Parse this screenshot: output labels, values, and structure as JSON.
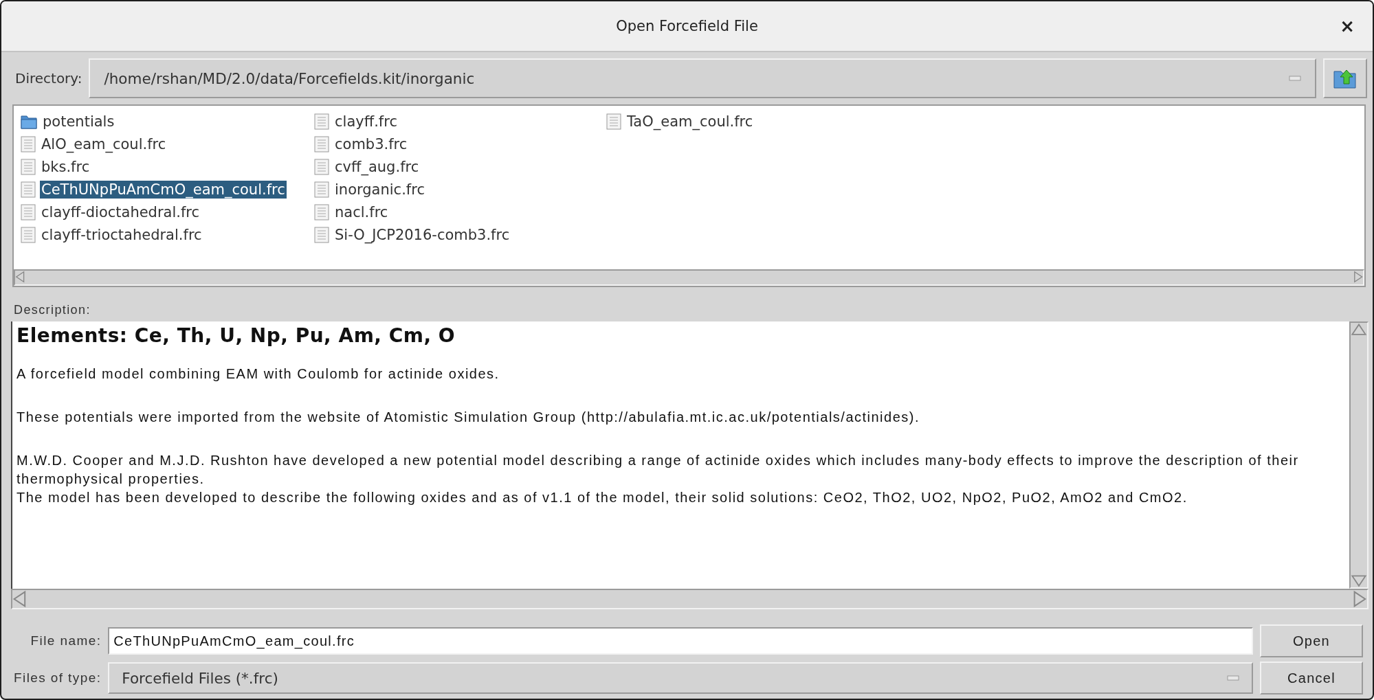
{
  "window": {
    "title": "Open Forcefield File",
    "close": "×"
  },
  "directory": {
    "label": "Directory:",
    "value": "/home/rshan/MD/2.0/data/Forcefields.kit/inorganic"
  },
  "files": [
    {
      "name": "potentials",
      "kind": "folder",
      "selected": false
    },
    {
      "name": "AlO_eam_coul.frc",
      "kind": "file",
      "selected": false
    },
    {
      "name": "bks.frc",
      "kind": "file",
      "selected": false
    },
    {
      "name": "CeThUNpPuAmCmO_eam_coul.frc",
      "kind": "file",
      "selected": true
    },
    {
      "name": "clayff-dioctahedral.frc",
      "kind": "file",
      "selected": false
    },
    {
      "name": "clayff-trioctahedral.frc",
      "kind": "file",
      "selected": false
    },
    {
      "name": "clayff.frc",
      "kind": "file",
      "selected": false
    },
    {
      "name": "comb3.frc",
      "kind": "file",
      "selected": false
    },
    {
      "name": "cvff_aug.frc",
      "kind": "file",
      "selected": false
    },
    {
      "name": "inorganic.frc",
      "kind": "file",
      "selected": false
    },
    {
      "name": "nacl.frc",
      "kind": "file",
      "selected": false
    },
    {
      "name": "Si-O_JCP2016-comb3.frc",
      "kind": "file",
      "selected": false
    },
    {
      "name": "TaO_eam_coul.frc",
      "kind": "file",
      "selected": false
    }
  ],
  "description": {
    "label": "Description:",
    "heading": "Elements: Ce, Th, U, Np, Pu, Am, Cm, O",
    "paragraphs": [
      [
        "A forcefield model combining EAM with Coulomb for actinide oxides."
      ],
      [
        "These potentials were imported from the website of Atomistic Simulation Group (http://abulafia.mt.ic.ac.uk/potentials/actinides)."
      ],
      [
        "M.W.D. Cooper and M.J.D. Rushton have developed a new potential model describing a range of actinide oxides which includes many-body effects to improve the description of their thermophysical properties.",
        "The model has been developed to describe the following oxides and as of v1.1 of the model, their solid solutions: CeO2, ThO2, UO2, NpO2, PuO2, AmO2 and CmO2."
      ]
    ]
  },
  "file_name": {
    "label": "File name:",
    "value": "CeThUNpPuAmCmO_eam_coul.frc"
  },
  "file_type": {
    "label": "Files of type:",
    "value": "Forcefield Files (*.frc)"
  },
  "buttons": [
    {
      "label": "Open"
    },
    {
      "label": "Cancel"
    }
  ]
}
